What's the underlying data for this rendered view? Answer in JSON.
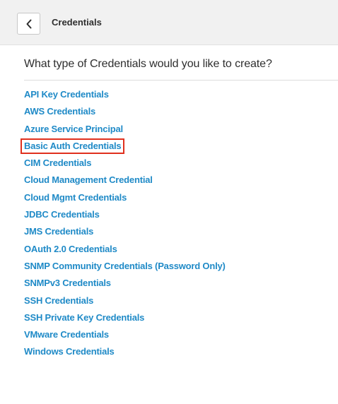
{
  "header": {
    "back_icon": "chevron-left-icon",
    "title": "Credentials"
  },
  "main": {
    "question": "What type of Credentials would you like to create?",
    "credential_types": [
      {
        "label": "API Key Credentials",
        "highlighted": false
      },
      {
        "label": "AWS Credentials",
        "highlighted": false
      },
      {
        "label": "Azure Service Principal",
        "highlighted": false
      },
      {
        "label": "Basic Auth Credentials",
        "highlighted": true
      },
      {
        "label": "CIM Credentials",
        "highlighted": false
      },
      {
        "label": "Cloud Management Credential",
        "highlighted": false
      },
      {
        "label": "Cloud Mgmt Credentials",
        "highlighted": false
      },
      {
        "label": "JDBC Credentials",
        "highlighted": false
      },
      {
        "label": "JMS Credentials",
        "highlighted": false
      },
      {
        "label": "OAuth 2.0 Credentials",
        "highlighted": false
      },
      {
        "label": "SNMP Community Credentials (Password Only)",
        "highlighted": false
      },
      {
        "label": "SNMPv3 Credentials",
        "highlighted": false
      },
      {
        "label": "SSH Credentials",
        "highlighted": false
      },
      {
        "label": "SSH Private Key Credentials",
        "highlighted": false
      },
      {
        "label": "VMware Credentials",
        "highlighted": false
      },
      {
        "label": "Windows Credentials",
        "highlighted": false
      }
    ]
  },
  "colors": {
    "link": "#1f8ac7",
    "highlight_border": "#e0301e",
    "header_bg": "#f1f1f1",
    "text": "#2e2e2e"
  }
}
